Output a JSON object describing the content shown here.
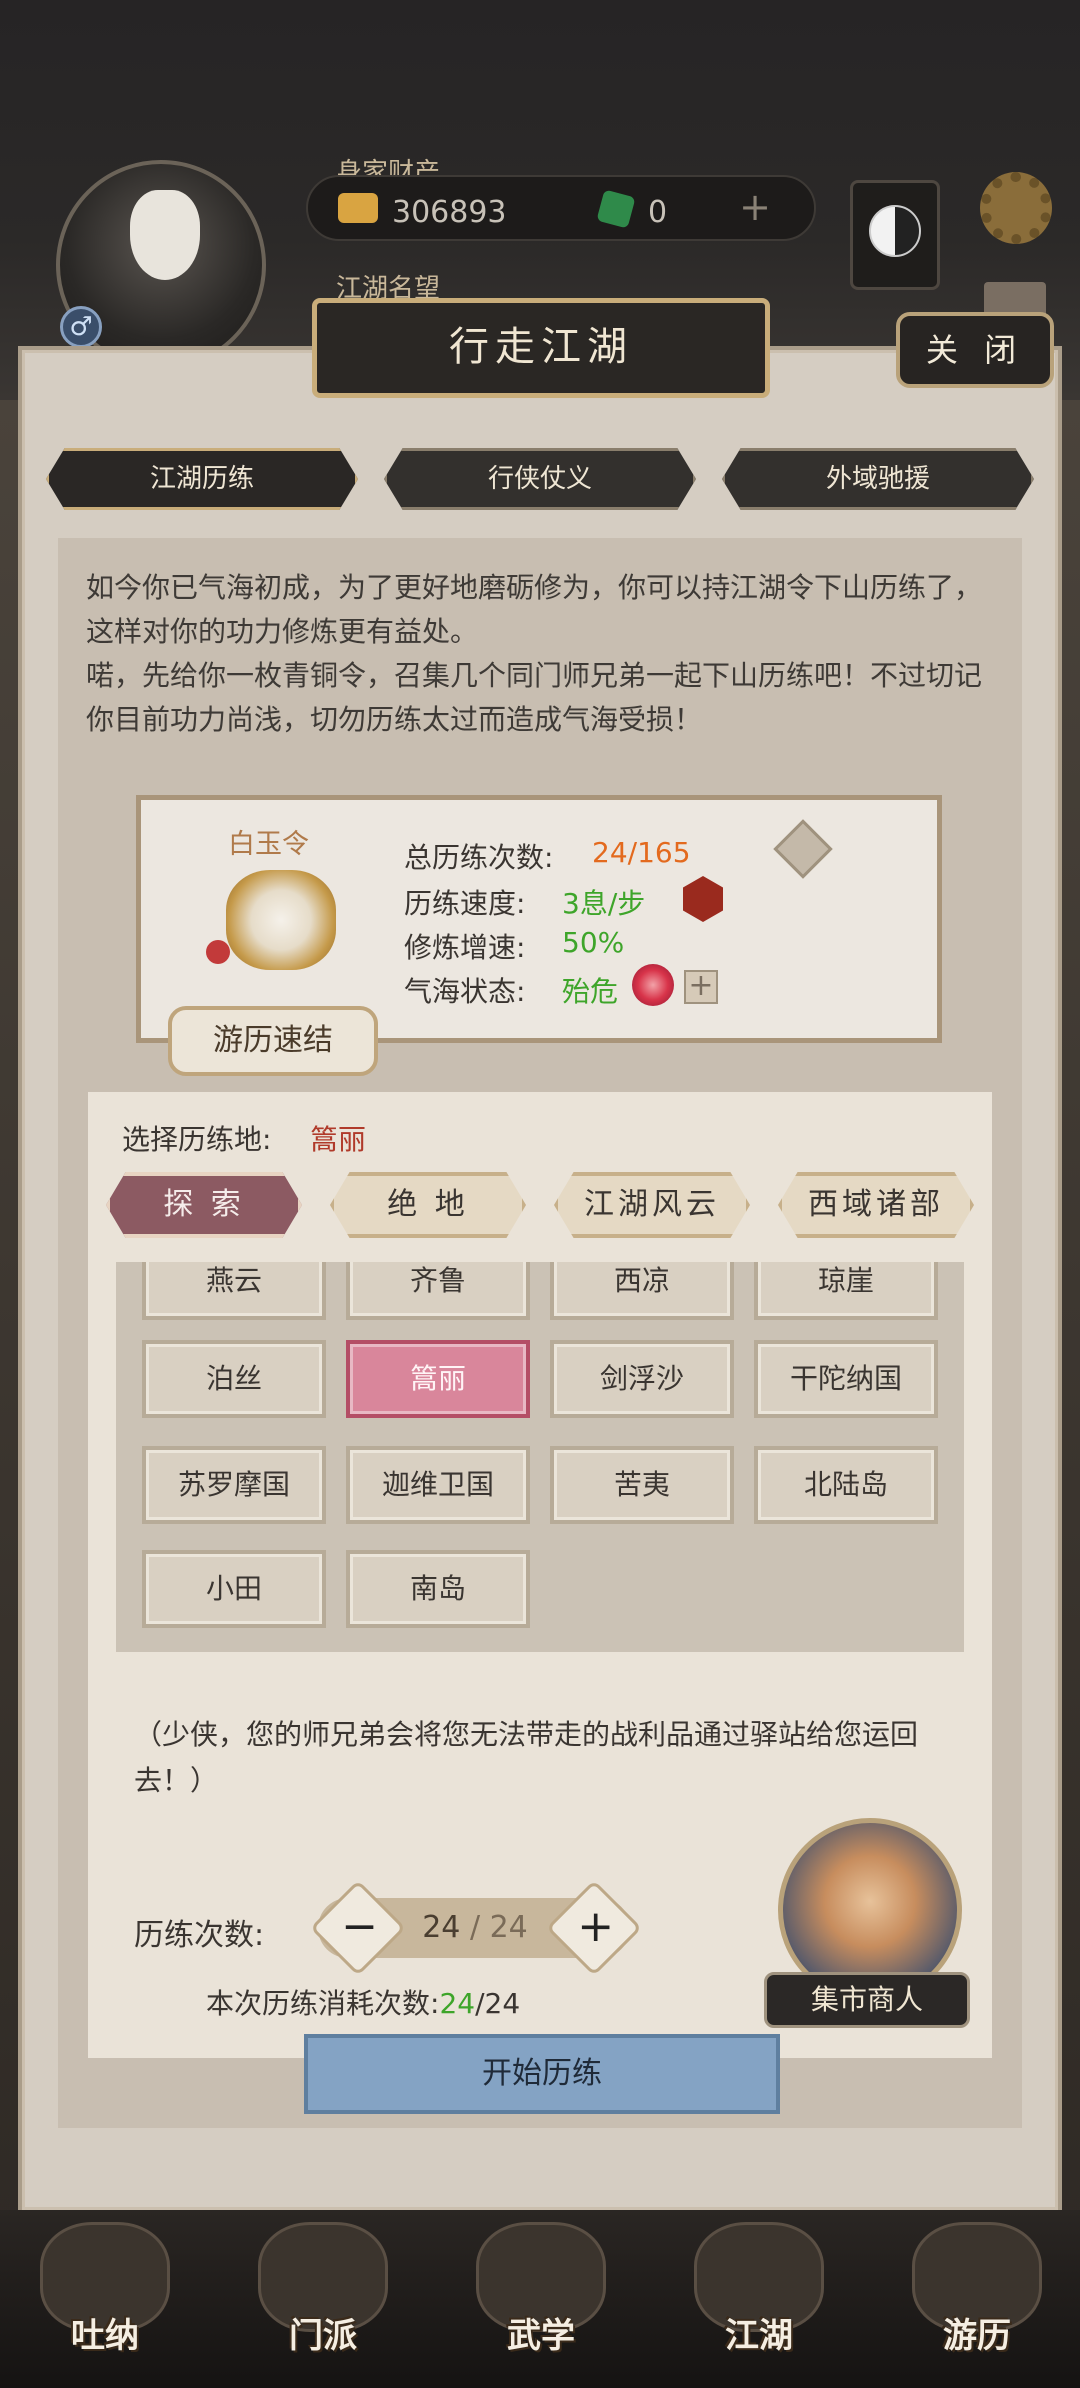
{
  "header": {
    "wealth_label": "身家财产",
    "gold": "306893",
    "jade": "0",
    "fame_label": "江湖名望",
    "gender_symbol": "♂"
  },
  "dialog": {
    "title": "行走江湖",
    "close_label": "关 闭",
    "tabs": [
      {
        "label": "江湖历练",
        "active": true
      },
      {
        "label": "行侠仗义",
        "active": false
      },
      {
        "label": "外域驰援",
        "active": false
      }
    ],
    "intro_1": "如今你已气海初成，为了更好地磨砺修为，你可以持江湖令下山历练了，这样对你的功力修炼更有益处。",
    "intro_2": "喏，先给你一枚青铜令，召集几个同门师兄弟一起下山历练吧！不过切记你目前功力尚浅，切勿历练太过而造成气海受损！"
  },
  "token": {
    "name": "白玉令",
    "quick_button": "游历速结",
    "stats": [
      {
        "label": "总历练次数:",
        "value": "24/165"
      },
      {
        "label": "历练速度:",
        "value": "3息/步"
      },
      {
        "label": "修炼增速:",
        "value": "50%"
      },
      {
        "label": "气海状态:",
        "value": "殆危"
      }
    ],
    "plus_symbol": "+"
  },
  "location": {
    "select_label": "选择历练地:",
    "selected": "篙丽",
    "categories": [
      {
        "label": "探 索",
        "active": true
      },
      {
        "label": "绝 地",
        "active": false
      },
      {
        "label": "江湖风云",
        "active": false
      },
      {
        "label": "西域诸部",
        "active": false
      }
    ],
    "places": [
      "燕云",
      "齐鲁",
      "西凉",
      "琼崖",
      "泊丝",
      "篙丽",
      "剑浮沙",
      "干陀纳国",
      "苏罗摩国",
      "迦维卫国",
      "苦夷",
      "北陆岛",
      "小田",
      "南岛"
    ]
  },
  "footer": {
    "note": "（少侠，您的师兄弟会将您无法带走的战利品通过驿站给您运回去！）",
    "count_label": "历练次数:",
    "count_current": "24",
    "count_sep": " / ",
    "count_max": "24",
    "minus": "−",
    "plus": "+",
    "cost_label": "本次历练消耗次数:",
    "cost_value": "24",
    "cost_max": "/24",
    "merchant_label": "集市商人",
    "start_button": "开始历练"
  },
  "nav": [
    {
      "label": "吐纳",
      "icon": "breathing-icon"
    },
    {
      "label": "门派",
      "icon": "sect-icon"
    },
    {
      "label": "武学",
      "icon": "martial-arts-icon"
    },
    {
      "label": "江湖",
      "icon": "jianghu-icon"
    },
    {
      "label": "游历",
      "icon": "travel-icon"
    }
  ],
  "colors": {
    "accent_gold": "#c9ad7a",
    "stat_orange": "#e36a1e",
    "stat_green": "#3ea52a",
    "selected_red": "#b03a2a",
    "start_blue": "#84a3c4"
  }
}
